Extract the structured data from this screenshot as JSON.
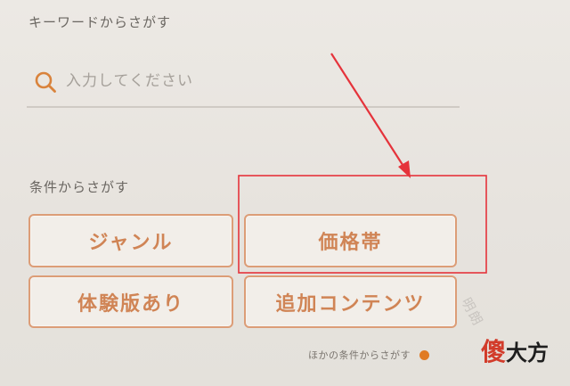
{
  "search": {
    "section_label": "キーワードからさがす",
    "placeholder": "入力してください",
    "value": ""
  },
  "conditions": {
    "section_label": "条件からさがす",
    "buttons": {
      "genre": "ジャンル",
      "price": "価格帯",
      "trial": "体験版あり",
      "dlc": "追加コンテンツ"
    },
    "other_link": "ほかの条件からさがす"
  },
  "colors": {
    "accent": "#d08455",
    "button_border": "#dc9d77",
    "annotation": "#e5333b",
    "dot": "#e07b24"
  },
  "watermark": {
    "diagonal_text": "明朗",
    "logo_char_1": "傻",
    "logo_rest": "大方"
  },
  "icons": {
    "search": "search-icon",
    "dot": "orange-dot-icon"
  }
}
